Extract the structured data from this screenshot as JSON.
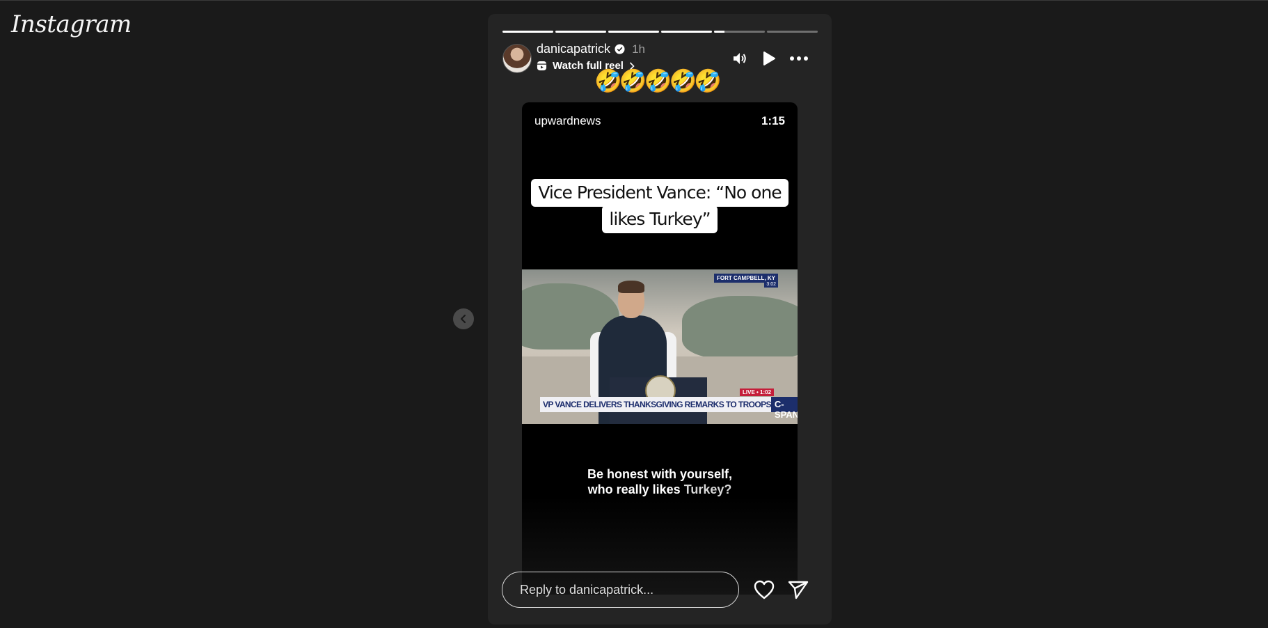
{
  "app": {
    "logo": "Instagram"
  },
  "story": {
    "progress_segments": [
      1,
      1,
      1,
      1,
      0.2,
      0
    ],
    "username": "danicapatrick",
    "time": "1h",
    "watch_full_reel": "Watch full reel",
    "emojis": "🤣🤣🤣🤣🤣",
    "reply_placeholder": "Reply to danicapatrick..."
  },
  "reel": {
    "username": "upwardnews",
    "duration": "1:15",
    "caption_line1": "Vice President Vance: “No one",
    "caption_line2": "likes Turkey”",
    "video": {
      "location_tag": "FORT CAMPBELL, KY",
      "clock": "3:02",
      "live_tag": "LIVE • 1:02",
      "chyron": "VP VANCE DELIVERS THANKSGIVING REMARKS TO TROOPS",
      "network": "C-SPAN"
    },
    "subtitle_line1": "Be honest with yourself,",
    "subtitle_line2_prefix": "who really likes ",
    "subtitle_line2_highlight": "Turkey?"
  },
  "icons": {
    "prev": "chevron-left-icon",
    "mute": "speaker-icon",
    "play": "play-icon",
    "more": "more-icon",
    "like": "heart-icon",
    "share": "send-icon"
  }
}
